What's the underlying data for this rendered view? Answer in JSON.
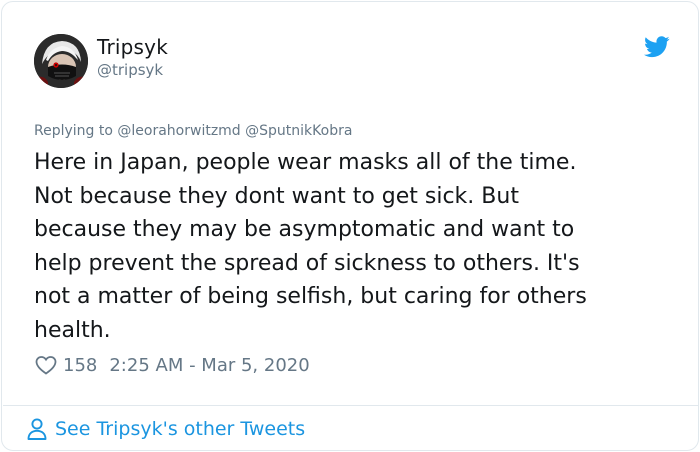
{
  "author": {
    "name": "Tripsyk",
    "handle": "@tripsyk",
    "avatar_icon": "avatar-masked-character"
  },
  "brand_icon": "twitter-bird-icon",
  "reply": {
    "prefix": "Replying to",
    "mentions": [
      "@leorahorwitzmd",
      "@SputnikKobra"
    ]
  },
  "tweet": {
    "text": "Here in Japan, people wear masks all of the time.\nNot because they dont want to get sick.  But\nbecause they may be asymptomatic and want to\nhelp prevent the spread of sickness to others. It's\nnot a matter of being selfish, but caring for others\nhealth."
  },
  "meta": {
    "likes": "158",
    "timestamp": "2:25 AM - Mar 5, 2020"
  },
  "footer": {
    "see_other": "See Tripsyk's other Tweets"
  },
  "colors": {
    "accent": "#1b95e0",
    "bird": "#1da1f2",
    "secondary_text": "#657786",
    "border": "#e1e8ed"
  }
}
